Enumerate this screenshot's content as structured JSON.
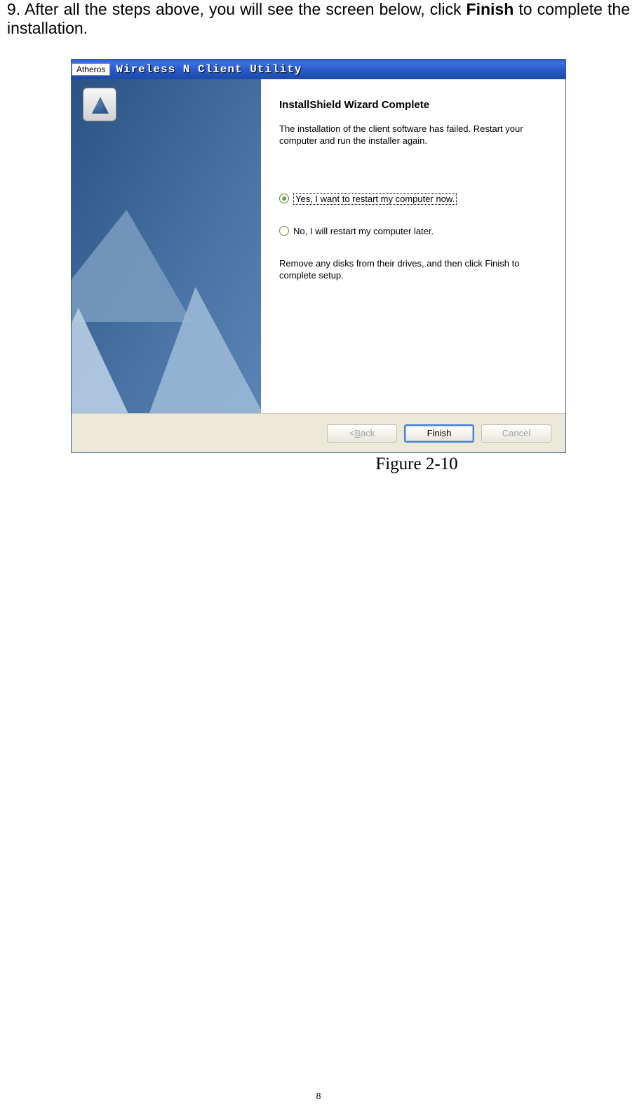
{
  "page": {
    "instruction_prefix": "9.  After  all  the  steps  above,  you  will  see  the  screen  below,  click ",
    "instruction_bold": "Finish",
    "instruction_suffix": "  to complete the installation.",
    "caption": "Figure 2-10",
    "page_number": "8"
  },
  "window": {
    "brand": "Atheros",
    "title": "Wireless N Client Utility",
    "wizard_heading": "InstallShield Wizard Complete",
    "message": "The installation of the client software has failed. Restart your computer and run the installer again.",
    "radio_yes": "Yes, I want to restart my computer now.",
    "radio_no": "No, I will restart my computer later.",
    "remove_disk": "Remove any disks from their drives, and then click Finish to complete setup.",
    "buttons": {
      "back_prefix": "< ",
      "back_underline": "B",
      "back_suffix": "ack",
      "finish": "Finish",
      "cancel": "Cancel"
    }
  }
}
